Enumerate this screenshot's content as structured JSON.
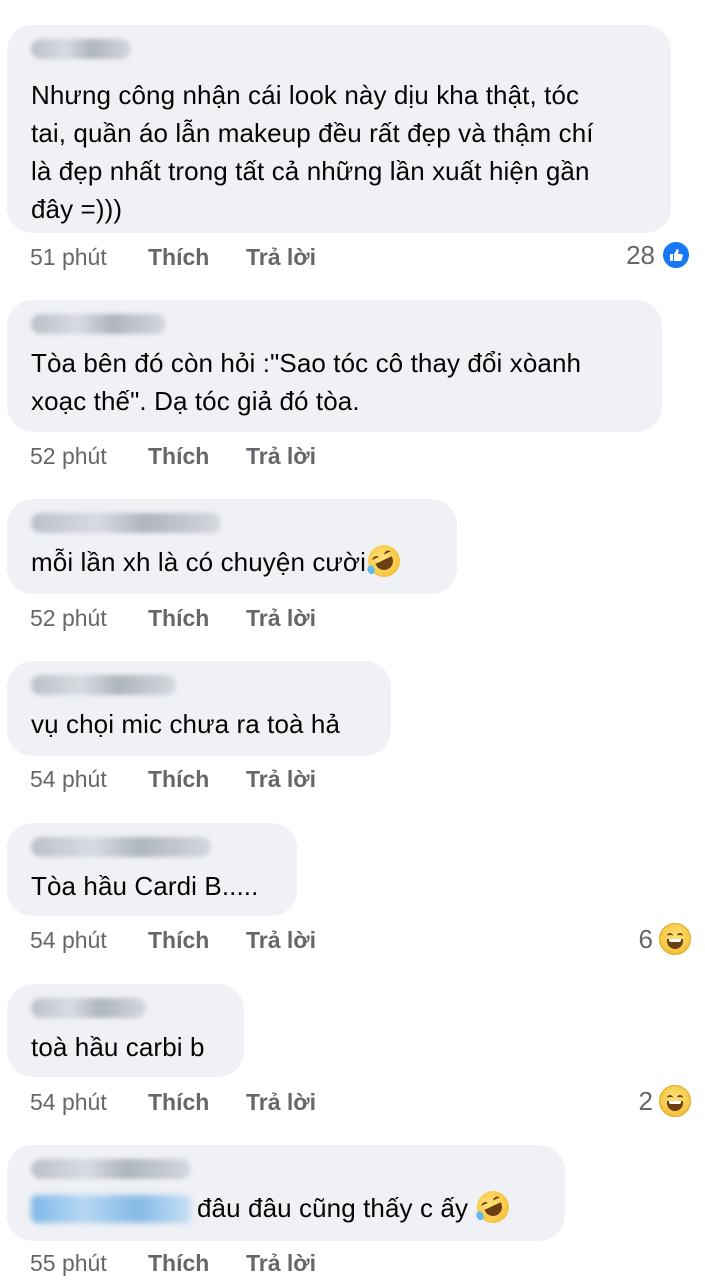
{
  "comments": [
    {
      "text": "Nhưng công nhận cái look này dịu kha thật, tóc\ntai, quần áo lẫn makeup đều rất đẹp và thậm chí\nlà đẹp nhất trong tất cả những lần xuất hiện gần\nđây =)))",
      "time": "51 phút",
      "like": "Thích",
      "reply": "Trả lời",
      "reaction_count": "28",
      "reaction_icon": "like-icon"
    },
    {
      "text": "Tòa bên đó còn hỏi :\"Sao tóc cô thay đổi xòanh\nxoạc thế\". Dạ tóc giả đó tòa.",
      "time": "52 phút",
      "like": "Thích",
      "reply": "Trả lời"
    },
    {
      "text": "mỗi lần xh là có chuyện cười",
      "emoji": "rofl-icon",
      "time": "52 phút",
      "like": "Thích",
      "reply": "Trả lời"
    },
    {
      "text": "vụ chọi mic chưa ra toà hả",
      "time": "54 phút",
      "like": "Thích",
      "reply": "Trả lời"
    },
    {
      "text": "Tòa hầu Cardi B.....",
      "time": "54 phút",
      "like": "Thích",
      "reply": "Trả lời",
      "reaction_count": "6",
      "reaction_icon": "haha-icon"
    },
    {
      "text": "toà hầu carbi b",
      "time": "54 phút",
      "like": "Thích",
      "reply": "Trả lời",
      "reaction_count": "2",
      "reaction_icon": "haha-icon"
    },
    {
      "text": "đâu đâu cũng thấy c ấy",
      "emoji": "rofl-icon",
      "time": "55 phút",
      "like": "Thích",
      "reply": "Trả lời"
    }
  ],
  "colors": {
    "bubble": "#eff1f4",
    "meta_text": "#65676b",
    "like_blue": "#1877f2"
  }
}
